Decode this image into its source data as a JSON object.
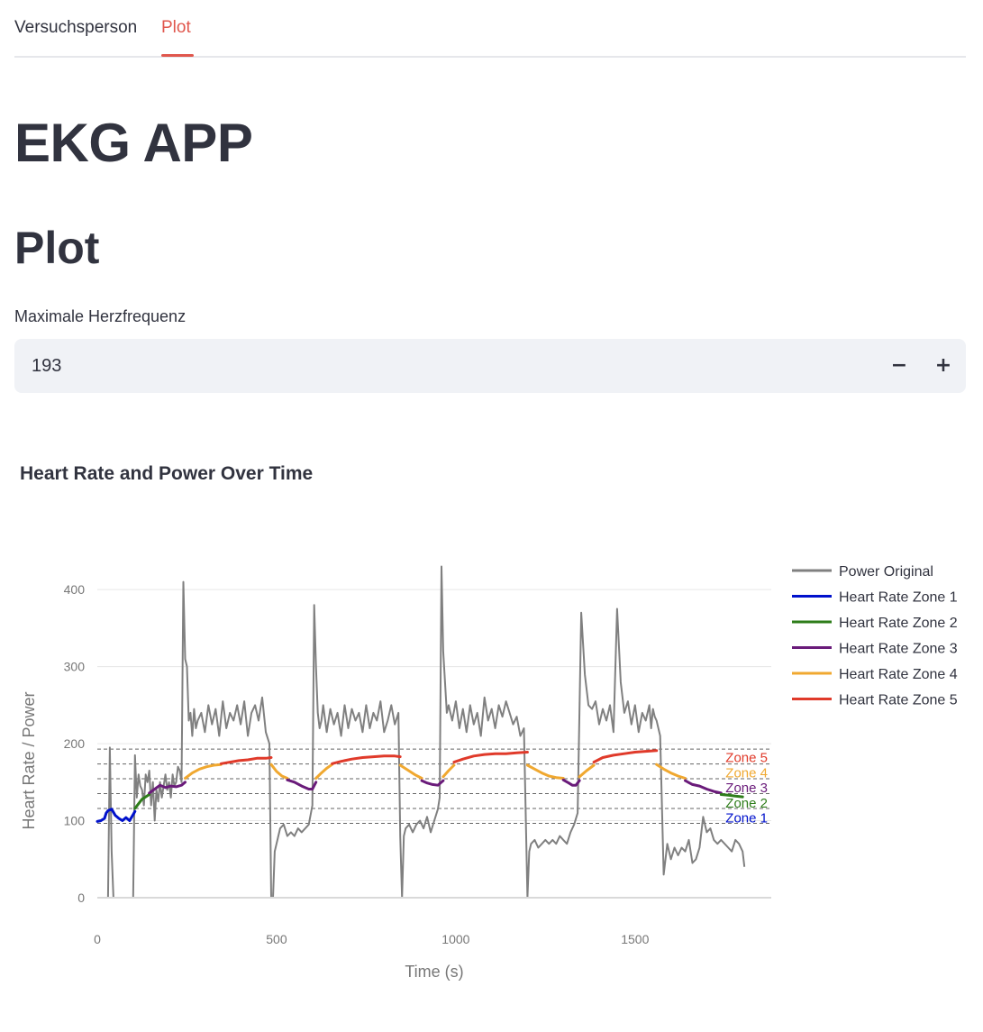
{
  "tabs": [
    {
      "label": "Versuchsperson",
      "active": false
    },
    {
      "label": "Plot",
      "active": true
    }
  ],
  "app_title": "EKG APP",
  "section_title": "Plot",
  "max_hr": {
    "label": "Maximale Herzfrequenz",
    "value": "193",
    "minus": "−",
    "plus": "+"
  },
  "colors": {
    "accent": "#e0574d",
    "power": "#808080",
    "zone1": "#0011cc",
    "zone2": "#2e7d1a",
    "zone3": "#6a1b7a",
    "zone4": "#f0a830",
    "zone5": "#e03a2a"
  },
  "chart_data": {
    "type": "line",
    "title": "Heart Rate and Power Over Time",
    "xlabel": "Time (s)",
    "ylabel": "Heart Rate / Power",
    "xlim": [
      0,
      1880
    ],
    "ylim": [
      0,
      440
    ],
    "x_ticks": [
      0,
      500,
      1000,
      1500
    ],
    "y_ticks": [
      0,
      100,
      200,
      300,
      400
    ],
    "grid": "horizontal",
    "legend_position": "right",
    "legend": [
      "Power Original",
      "Heart Rate Zone 1",
      "Heart Rate Zone 2",
      "Heart Rate Zone 3",
      "Heart Rate Zone 4",
      "Heart Rate Zone 5"
    ],
    "zone_thresholds": [
      96.5,
      115.8,
      135.1,
      154.4,
      173.7,
      193
    ],
    "zone_labels": [
      {
        "text": "Zone 5",
        "y": 183,
        "color": "#e03a2a"
      },
      {
        "text": "Zone 4",
        "y": 163,
        "color": "#f0a830"
      },
      {
        "text": "Zone 3",
        "y": 144,
        "color": "#6a1b7a"
      },
      {
        "text": "Zone 2",
        "y": 124,
        "color": "#2e7d1a"
      },
      {
        "text": "Zone 1",
        "y": 105,
        "color": "#0011cc"
      }
    ],
    "power": {
      "name": "Power Original",
      "x": [
        0,
        10,
        20,
        30,
        35,
        40,
        45,
        50,
        60,
        70,
        80,
        90,
        100,
        105,
        110,
        115,
        120,
        125,
        130,
        135,
        140,
        145,
        150,
        155,
        160,
        165,
        170,
        175,
        180,
        185,
        190,
        195,
        200,
        205,
        210,
        215,
        220,
        225,
        230,
        235,
        240,
        245,
        250,
        255,
        260,
        265,
        270,
        275,
        280,
        290,
        300,
        310,
        320,
        330,
        340,
        350,
        360,
        370,
        380,
        390,
        400,
        410,
        420,
        430,
        440,
        450,
        460,
        470,
        480,
        485,
        490,
        495,
        500,
        505,
        510,
        520,
        530,
        540,
        550,
        560,
        570,
        580,
        590,
        600,
        605,
        610,
        615,
        620,
        625,
        630,
        640,
        650,
        660,
        670,
        680,
        690,
        700,
        710,
        720,
        730,
        740,
        750,
        760,
        770,
        780,
        790,
        800,
        810,
        820,
        830,
        840,
        845,
        850,
        855,
        860,
        870,
        880,
        890,
        900,
        910,
        920,
        930,
        940,
        950,
        955,
        960,
        965,
        970,
        975,
        980,
        990,
        1000,
        1010,
        1020,
        1030,
        1040,
        1050,
        1060,
        1070,
        1080,
        1090,
        1100,
        1110,
        1120,
        1130,
        1140,
        1150,
        1160,
        1170,
        1180,
        1190,
        1200,
        1205,
        1210,
        1220,
        1230,
        1240,
        1250,
        1260,
        1270,
        1280,
        1290,
        1300,
        1310,
        1320,
        1330,
        1340,
        1350,
        1360,
        1370,
        1380,
        1390,
        1400,
        1410,
        1420,
        1430,
        1440,
        1450,
        1460,
        1470,
        1480,
        1490,
        1500,
        1510,
        1520,
        1530,
        1540,
        1545,
        1550,
        1555,
        1560,
        1570,
        1580,
        1590,
        1600,
        1610,
        1620,
        1630,
        1640,
        1650,
        1660,
        1670,
        1680,
        1690,
        1700,
        1710,
        1720,
        1730,
        1740,
        1750,
        1760,
        1770,
        1780,
        1790,
        1800,
        1805
      ],
      "y": [
        0,
        0,
        0,
        0,
        195,
        60,
        0,
        0,
        0,
        0,
        0,
        0,
        0,
        185,
        130,
        160,
        145,
        140,
        120,
        160,
        150,
        165,
        120,
        150,
        100,
        140,
        125,
        150,
        130,
        145,
        160,
        140,
        150,
        130,
        160,
        145,
        150,
        170,
        165,
        150,
        410,
        310,
        300,
        230,
        240,
        210,
        245,
        220,
        230,
        240,
        215,
        250,
        225,
        245,
        210,
        255,
        220,
        240,
        230,
        250,
        225,
        255,
        210,
        240,
        250,
        230,
        260,
        215,
        200,
        0,
        0,
        60,
        70,
        80,
        90,
        95,
        80,
        85,
        80,
        90,
        85,
        90,
        95,
        120,
        380,
        300,
        240,
        220,
        230,
        250,
        215,
        245,
        225,
        240,
        210,
        250,
        220,
        245,
        230,
        240,
        215,
        250,
        220,
        240,
        230,
        255,
        215,
        230,
        250,
        225,
        240,
        80,
        0,
        80,
        90,
        95,
        85,
        95,
        100,
        90,
        105,
        85,
        100,
        115,
        130,
        430,
        320,
        280,
        240,
        250,
        230,
        255,
        220,
        245,
        215,
        250,
        225,
        240,
        210,
        260,
        230,
        245,
        220,
        250,
        235,
        255,
        240,
        225,
        235,
        210,
        220,
        0,
        60,
        70,
        75,
        65,
        70,
        75,
        70,
        75,
        70,
        80,
        75,
        70,
        85,
        95,
        110,
        370,
        290,
        250,
        245,
        255,
        225,
        245,
        230,
        250,
        215,
        375,
        280,
        240,
        255,
        225,
        250,
        215,
        240,
        230,
        250,
        220,
        245,
        235,
        230,
        210,
        30,
        70,
        50,
        65,
        55,
        65,
        60,
        75,
        45,
        50,
        65,
        105,
        85,
        90,
        75,
        70,
        75,
        70,
        65,
        60,
        75,
        70,
        60,
        40,
        0
      ]
    },
    "hr_segments": [
      {
        "zone": 1,
        "x": [
          0,
          10,
          20,
          25,
          30,
          40,
          50,
          60,
          70,
          80,
          90,
          100,
          105
        ],
        "y": [
          99,
          100,
          103,
          110,
          113,
          115,
          107,
          103,
          100,
          104,
          100,
          108,
          112
        ]
      },
      {
        "zone": 2,
        "x": [
          105,
          115,
          125,
          135,
          145
        ],
        "y": [
          116,
          122,
          128,
          131,
          134
        ]
      },
      {
        "zone": 3,
        "x": [
          145,
          160,
          175,
          190,
          205,
          220,
          235,
          245
        ],
        "y": [
          136,
          141,
          146,
          143,
          145,
          144,
          146,
          150
        ]
      },
      {
        "zone": 4,
        "x": [
          245,
          265,
          285,
          305,
          325,
          345
        ],
        "y": [
          155,
          162,
          167,
          170,
          172,
          173
        ]
      },
      {
        "zone": 5,
        "x": [
          345,
          370,
          395,
          420,
          445,
          470,
          485
        ],
        "y": [
          174,
          176,
          178,
          179,
          181,
          181,
          182
        ]
      },
      {
        "zone": 4,
        "x": [
          485,
          500,
          515,
          530
        ],
        "y": [
          173,
          164,
          158,
          155
        ]
      },
      {
        "zone": 3,
        "x": [
          530,
          550,
          570,
          590,
          600,
          610
        ],
        "y": [
          153,
          150,
          145,
          141,
          141,
          150
        ]
      },
      {
        "zone": 4,
        "x": [
          610,
          625,
          640,
          655
        ],
        "y": [
          155,
          162,
          168,
          173
        ]
      },
      {
        "zone": 5,
        "x": [
          655,
          680,
          710,
          740,
          770,
          800,
          830,
          845
        ],
        "y": [
          174,
          177,
          180,
          182,
          183,
          184,
          184,
          183
        ]
      },
      {
        "zone": 4,
        "x": [
          845,
          865,
          885,
          905
        ],
        "y": [
          172,
          166,
          160,
          155
        ]
      },
      {
        "zone": 3,
        "x": [
          905,
          920,
          935,
          950,
          965
        ],
        "y": [
          152,
          149,
          147,
          146,
          152
        ]
      },
      {
        "zone": 4,
        "x": [
          965,
          980,
          995
        ],
        "y": [
          157,
          165,
          172
        ]
      },
      {
        "zone": 5,
        "x": [
          995,
          1020,
          1050,
          1080,
          1110,
          1140,
          1170,
          1200
        ],
        "y": [
          176,
          180,
          184,
          186,
          187,
          187,
          188,
          189
        ]
      },
      {
        "zone": 4,
        "x": [
          1200,
          1220,
          1240,
          1260,
          1280,
          1300
        ],
        "y": [
          172,
          167,
          162,
          158,
          156,
          155
        ]
      },
      {
        "zone": 3,
        "x": [
          1300,
          1315,
          1325,
          1335,
          1345
        ],
        "y": [
          153,
          149,
          146,
          146,
          152
        ]
      },
      {
        "zone": 4,
        "x": [
          1345,
          1365,
          1385
        ],
        "y": [
          157,
          165,
          172
        ]
      },
      {
        "zone": 5,
        "x": [
          1385,
          1410,
          1440,
          1470,
          1500,
          1530,
          1560
        ],
        "y": [
          176,
          182,
          185,
          187,
          189,
          190,
          191
        ]
      },
      {
        "zone": 4,
        "x": [
          1560,
          1580,
          1600,
          1620,
          1640
        ],
        "y": [
          173,
          167,
          162,
          158,
          155
        ]
      },
      {
        "zone": 3,
        "x": [
          1640,
          1660,
          1680,
          1700,
          1720,
          1740
        ],
        "y": [
          152,
          147,
          145,
          141,
          138,
          136
        ]
      },
      {
        "zone": 2,
        "x": [
          1740,
          1760,
          1780,
          1800
        ],
        "y": [
          134,
          133,
          132,
          131
        ]
      }
    ]
  }
}
